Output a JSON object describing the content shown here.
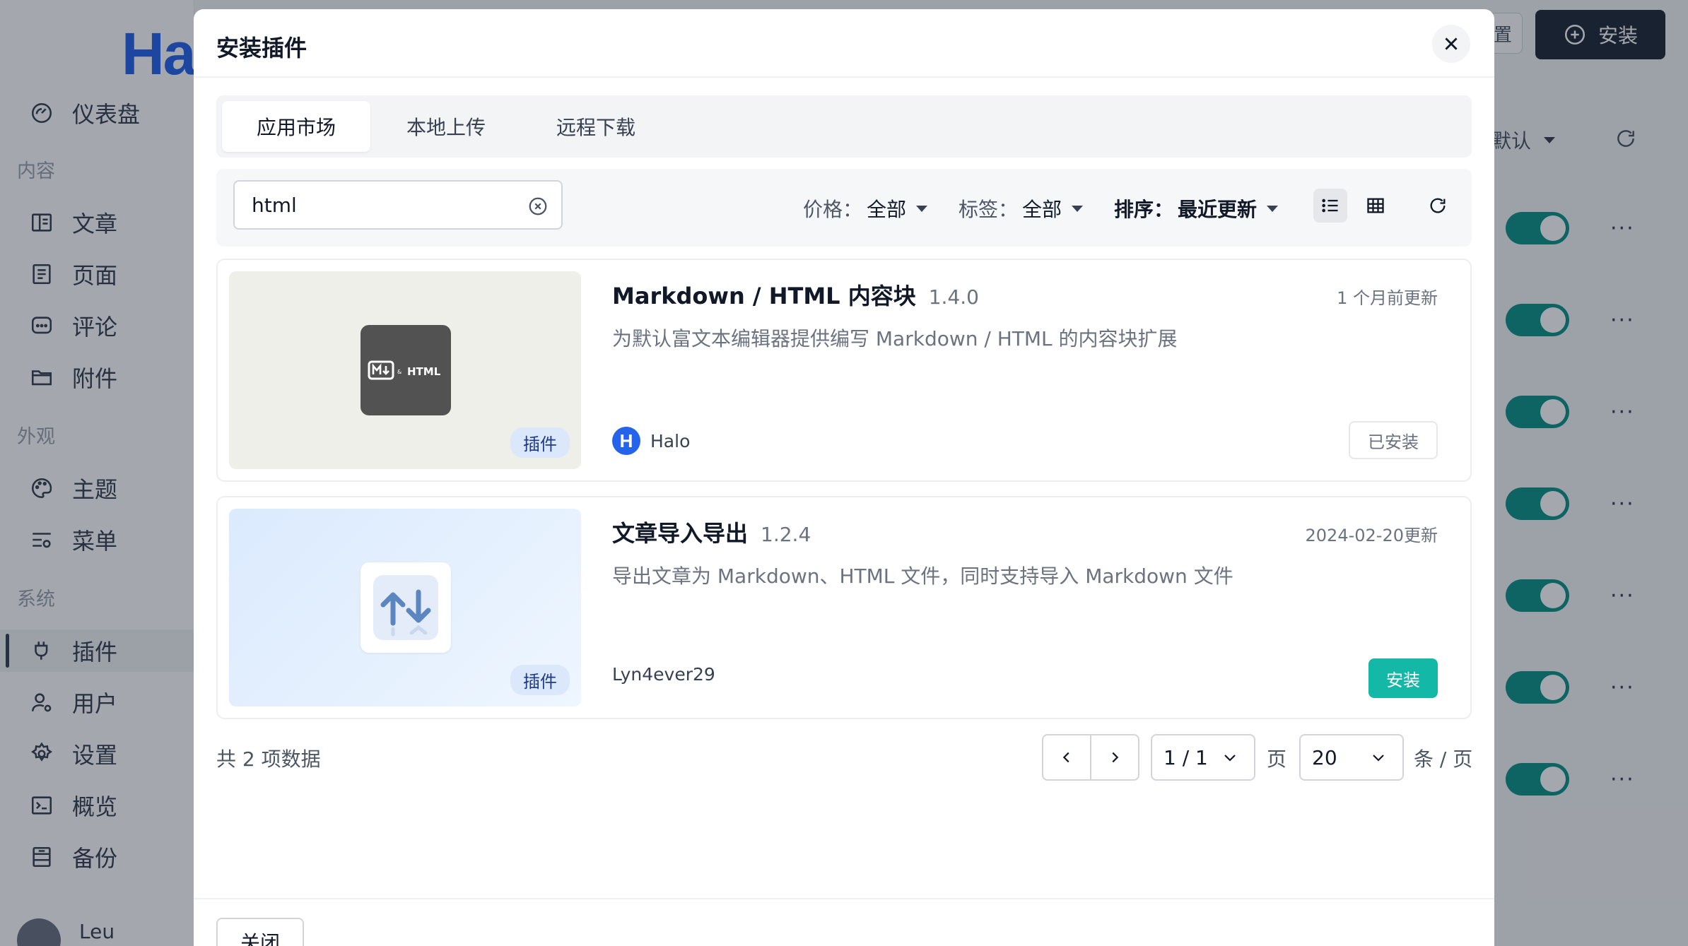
{
  "background": {
    "logo_text": "Ha",
    "nav": [
      {
        "label": "仪表盘",
        "icon": "dashboard-icon"
      },
      {
        "label": "文章",
        "icon": "book-icon"
      },
      {
        "label": "页面",
        "icon": "page-icon"
      },
      {
        "label": "评论",
        "icon": "comment-icon"
      },
      {
        "label": "附件",
        "icon": "folder-icon"
      },
      {
        "label": "主题",
        "icon": "palette-icon"
      },
      {
        "label": "菜单",
        "icon": "menu-icon"
      },
      {
        "label": "插件",
        "icon": "plug-icon"
      },
      {
        "label": "用户",
        "icon": "user-icon"
      },
      {
        "label": "设置",
        "icon": "gear-icon"
      },
      {
        "label": "概览",
        "icon": "terminal-icon"
      },
      {
        "label": "备份",
        "icon": "archive-icon"
      }
    ],
    "groups": {
      "content": "内容",
      "appearance": "外观",
      "system": "系统"
    },
    "user_name": "Leu",
    "top_ghost_label": "置",
    "top_install_label": "安装",
    "sort_value": "默认"
  },
  "modal": {
    "title": "安装插件",
    "tabs": [
      {
        "label": "应用市场",
        "active": true
      },
      {
        "label": "本地上传",
        "active": false
      },
      {
        "label": "远程下载",
        "active": false
      }
    ],
    "search": {
      "value": "html"
    },
    "filters": {
      "price_label": "价格：",
      "price_value": "全部",
      "tag_label": "标签：",
      "tag_value": "全部",
      "sort_label": "排序：",
      "sort_value": "最近更新"
    },
    "plugins": [
      {
        "name": "Markdown / HTML 内容块",
        "version": "1.4.0",
        "updated": "1 个月前更新",
        "description": "为默认富文本编辑器提供编写 Markdown / HTML 的内容块扩展",
        "badge": "插件",
        "author": "Halo",
        "author_logo": "H",
        "icon_text": "HTML",
        "icon_amp": "&",
        "action": "已安装"
      },
      {
        "name": "文章导入导出",
        "version": "1.2.4",
        "updated": "2024-02-20更新",
        "description": "导出文章为 Markdown、HTML 文件，同时支持导入 Markdown 文件",
        "badge": "插件",
        "author": "Lyn4ever29",
        "action": "安装"
      }
    ],
    "total_text": "共 2 项数据",
    "page_value": "1 / 1",
    "page_label": "页",
    "page_size": "20",
    "page_size_label": "条 / 页",
    "close_label": "关闭"
  }
}
